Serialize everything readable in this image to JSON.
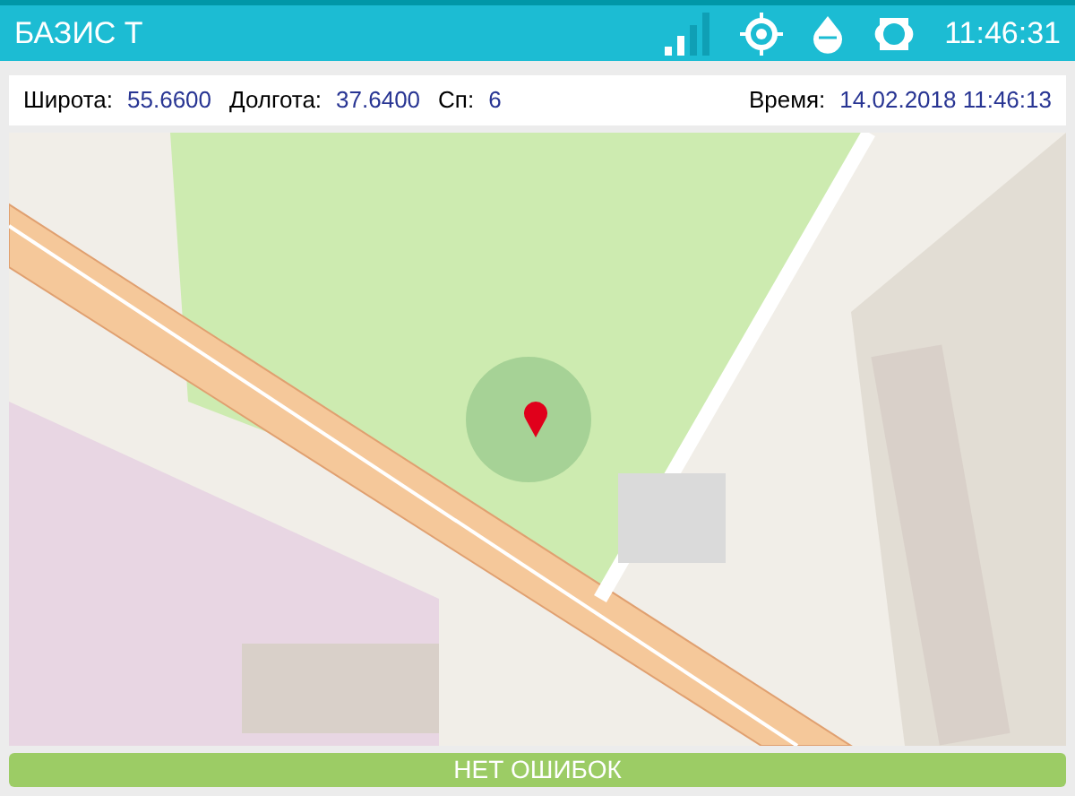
{
  "header": {
    "title": "БАЗИС Т",
    "clock": "11:46:31"
  },
  "info": {
    "fields": [
      {
        "label": "Широта:",
        "value": "55.6600"
      },
      {
        "label": "Долгота:",
        "value": "37.6400"
      },
      {
        "label": "Сп:",
        "value": "6"
      }
    ],
    "time": {
      "label": "Время:",
      "value": "14.02.2018 11:46:13"
    }
  },
  "status": {
    "text": "НЕТ ОШИБОК"
  }
}
